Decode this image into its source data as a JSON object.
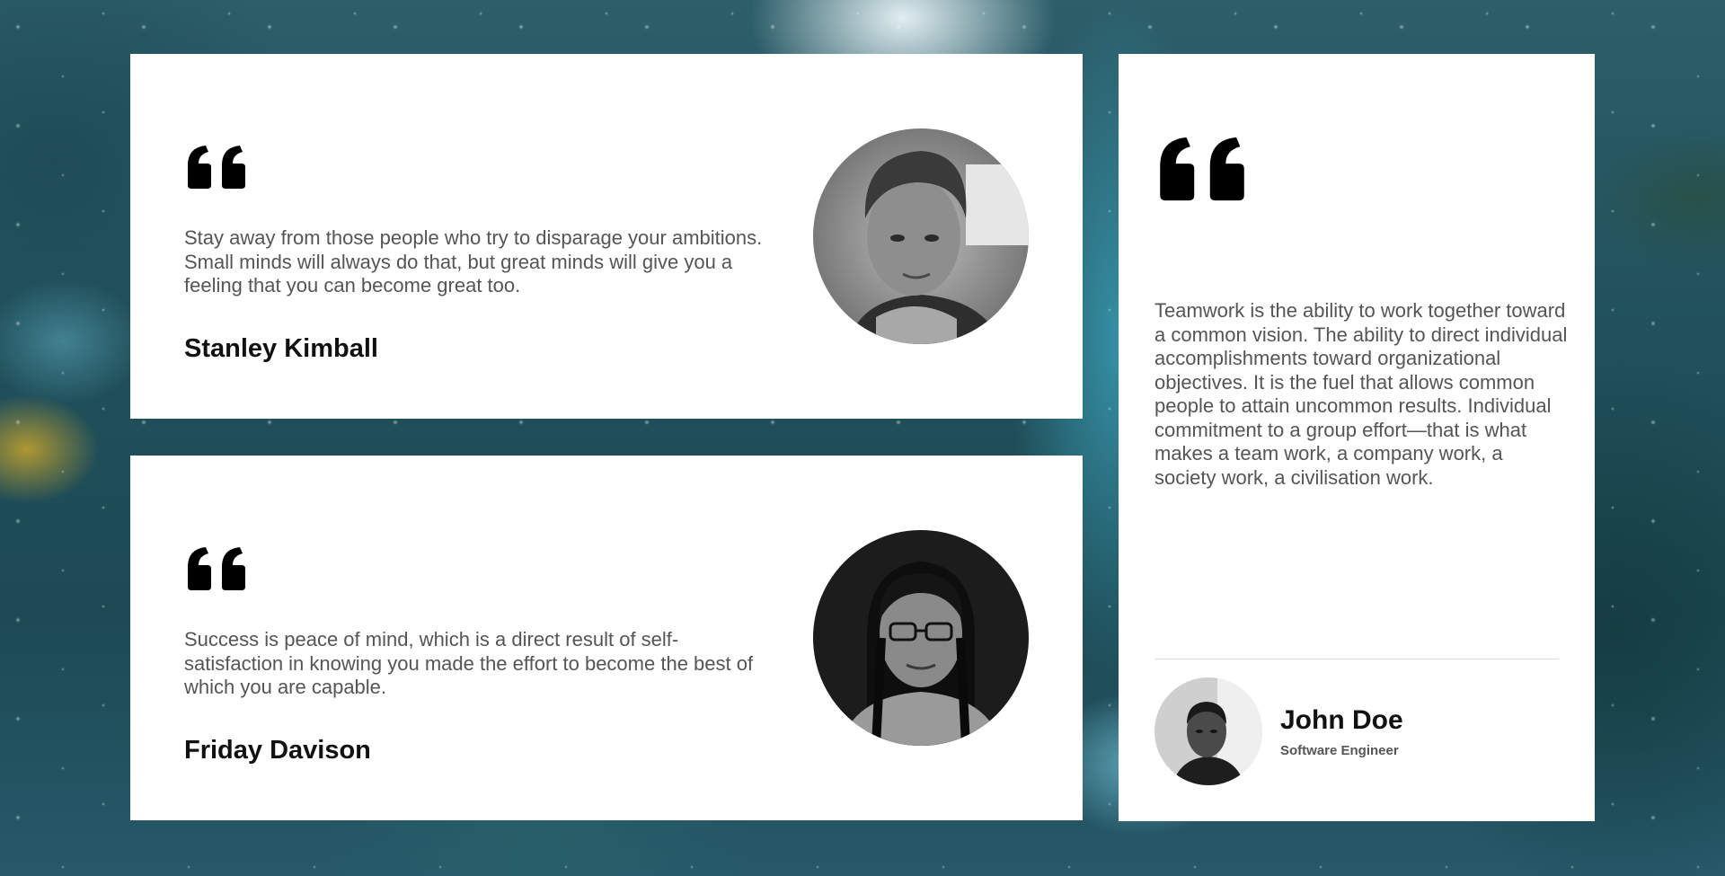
{
  "colors": {
    "card_background": "#ffffff",
    "quote_mark": "#000000",
    "quote_text": "#555555",
    "author_name": "#111111",
    "divider": "#dddddd"
  },
  "icons": {
    "quote_mark": "double-quote-icon"
  },
  "testimonials": [
    {
      "text": "Stay away from those people who try to disparage your ambitions. Small minds will always do that, but great minds will give you a feeling that you can become great too.",
      "author": "Stanley Kimball",
      "photo": "stanley-kimball-avatar"
    },
    {
      "text": "Success is peace of mind, which is a direct result of self-satisfaction in knowing you made the effort to become the best of which you are capable.",
      "author": "Friday Davison",
      "photo": "friday-davison-avatar"
    }
  ],
  "featured": {
    "text": "Teamwork is the ability to work together toward a common vision. The ability to direct individual accomplishments toward organizational objectives. It is the fuel that allows common people to attain uncommon results. Individual commitment to a group effort—that is what makes a team work, a company work, a society work, a civilisation work.",
    "author": "John Doe",
    "role": "Software Engineer",
    "photo": "john-doe-avatar"
  }
}
